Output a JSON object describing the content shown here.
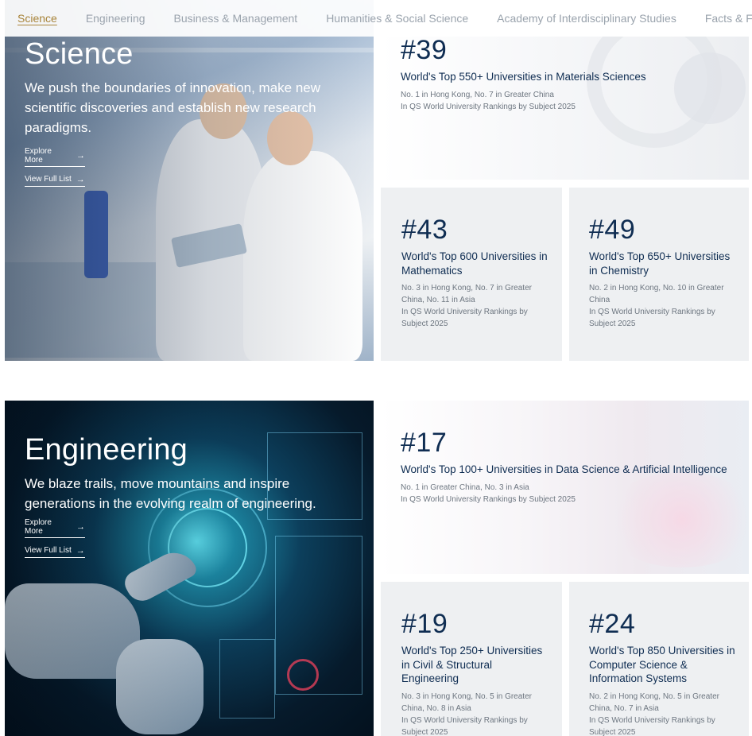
{
  "tabs": [
    {
      "label": "Science",
      "active": true
    },
    {
      "label": "Engineering",
      "active": false
    },
    {
      "label": "Business & Management",
      "active": false
    },
    {
      "label": "Humanities & Social Science",
      "active": false
    },
    {
      "label": "Academy of Interdisciplinary Studies",
      "active": false
    },
    {
      "label": "Facts & Figures",
      "active": false
    }
  ],
  "science": {
    "title": "Science",
    "description": "We push the boundaries of innovation, make new scientific discoveries and establish new research paradigms.",
    "explore_label": "Explore More",
    "view_label": "View Full List",
    "cards": [
      {
        "rank": "#39",
        "title": "World's Top 550+ Universities in Materials Sciences",
        "sub1": "No. 1 in Hong Kong, No. 7 in Greater China",
        "sub2": "In QS World University Rankings by Subject 2025"
      },
      {
        "rank": "#43",
        "title": "World's Top 600 Universities in Mathematics",
        "sub1": "No. 3 in Hong Kong, No. 7 in Greater China, No. 11 in Asia",
        "sub2": "In QS World University Rankings by Subject 2025"
      },
      {
        "rank": "#49",
        "title": "World's Top 650+ Universities in Chemistry",
        "sub1": "No. 2 in Hong Kong, No. 10 in Greater China",
        "sub2": "In QS World University Rankings by Subject 2025"
      }
    ]
  },
  "engineering": {
    "title": "Engineering",
    "description": "We blaze trails, move mountains and inspire generations in the evolving realm of engineering.",
    "explore_label": "Explore More",
    "view_label": "View Full List",
    "cards": [
      {
        "rank": "#17",
        "title": "World's Top 100+ Universities in Data Science & Artificial Intelligence",
        "sub1": "No. 1 in Greater China, No. 3 in Asia",
        "sub2": "In QS World University Rankings by Subject 2025"
      },
      {
        "rank": "#19",
        "title": "World's Top 250+ Universities in Civil & Structural Engineering",
        "sub1": "No. 3 in Hong Kong, No. 5 in Greater China, No. 8 in Asia",
        "sub2": "In QS World University Rankings by Subject 2025"
      },
      {
        "rank": "#24",
        "title": "World's Top 850 Universities in Computer Science & Information Systems",
        "sub1": "No. 2 in Hong Kong, No. 5 in Greater China, No. 7 in Asia",
        "sub2": "In QS World University Rankings by Subject 2025"
      }
    ]
  },
  "colors": {
    "accent_gold": "#a8843a",
    "navy": "#0f2d52",
    "muted": "#9aa3ad"
  },
  "icons": {
    "link_arrow": "arrow-right-icon"
  }
}
